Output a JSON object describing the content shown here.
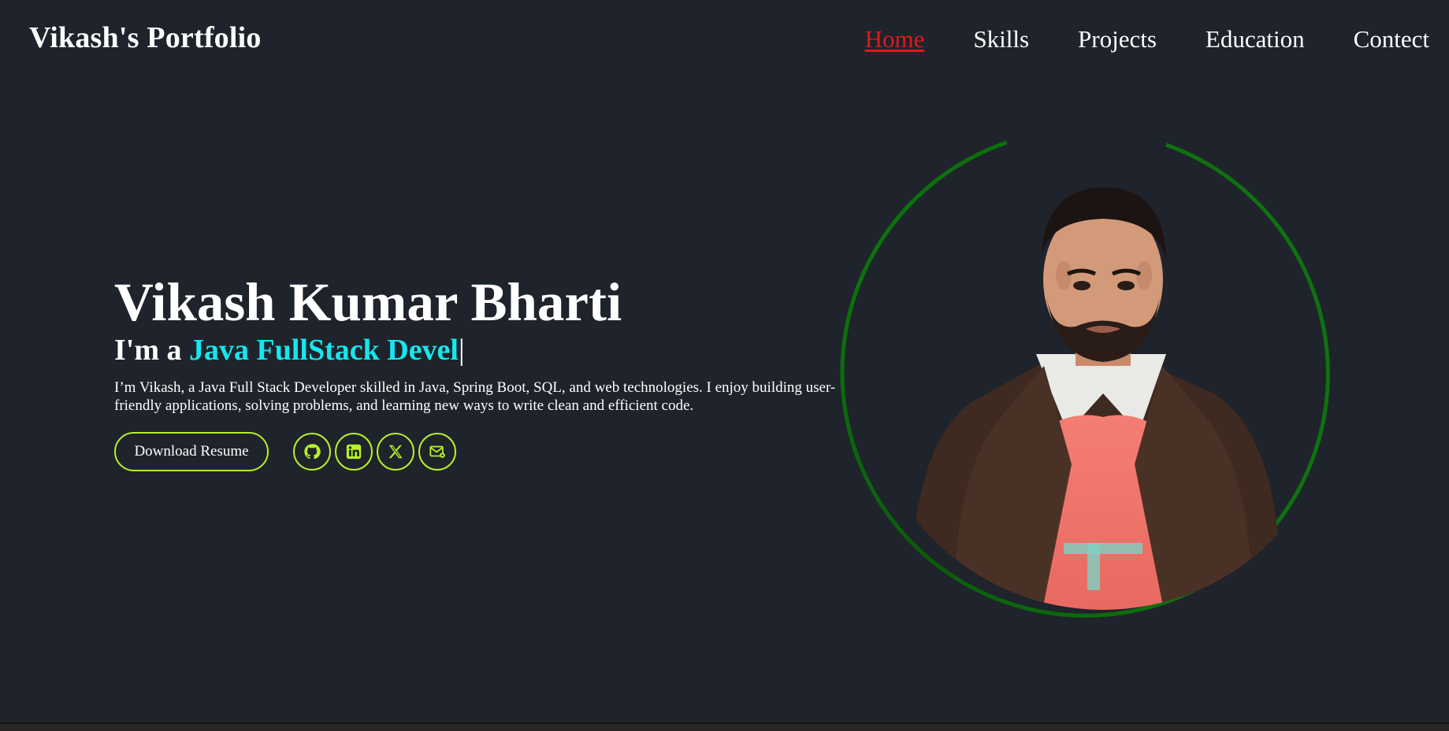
{
  "header": {
    "brand": "Vikash's Portfolio",
    "nav": [
      "Home",
      "Skills",
      "Projects",
      "Education",
      "Contect"
    ],
    "active_nav": "Home"
  },
  "hero": {
    "name": "Vikash Kumar Bharti",
    "role_prefix": "I'm a ",
    "role_typed": "Java FullStack Devel",
    "cursor": "|",
    "description": "I’m Vikash, a Java Full Stack Developer skilled in Java, Spring Boot, SQL, and web technologies. I enjoy building user-friendly applications, solving problems, and learning new ways to write clean and efficient code.",
    "resume_button": "Download Resume",
    "socials": [
      "github-icon",
      "linkedin-icon",
      "x-icon",
      "mail-icon"
    ]
  },
  "colors": {
    "background": "#1f232b",
    "accent_border": "#b4f02c",
    "typed_text": "#16e6ee",
    "active_nav": "#e01818",
    "ring": "#0c7a0c"
  }
}
